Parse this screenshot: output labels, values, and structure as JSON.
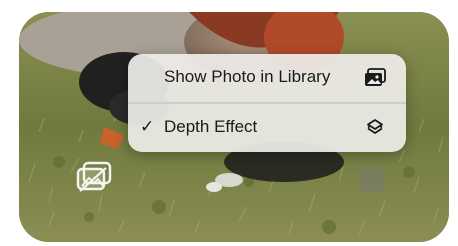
{
  "context_menu": {
    "items": [
      {
        "label": "Show Photo in Library",
        "checked": false,
        "icon": "photo-library-icon"
      },
      {
        "label": "Depth Effect",
        "checked": true,
        "check_glyph": "✓",
        "icon": "depth-layers-icon"
      }
    ]
  },
  "photo": {
    "subject": "duck on grass",
    "overlay_icon": "live-photo-depth-icon"
  },
  "colors": {
    "menu_background": "#eeece8",
    "menu_text": "#1a1a1a",
    "grass": "#6e7c43"
  }
}
